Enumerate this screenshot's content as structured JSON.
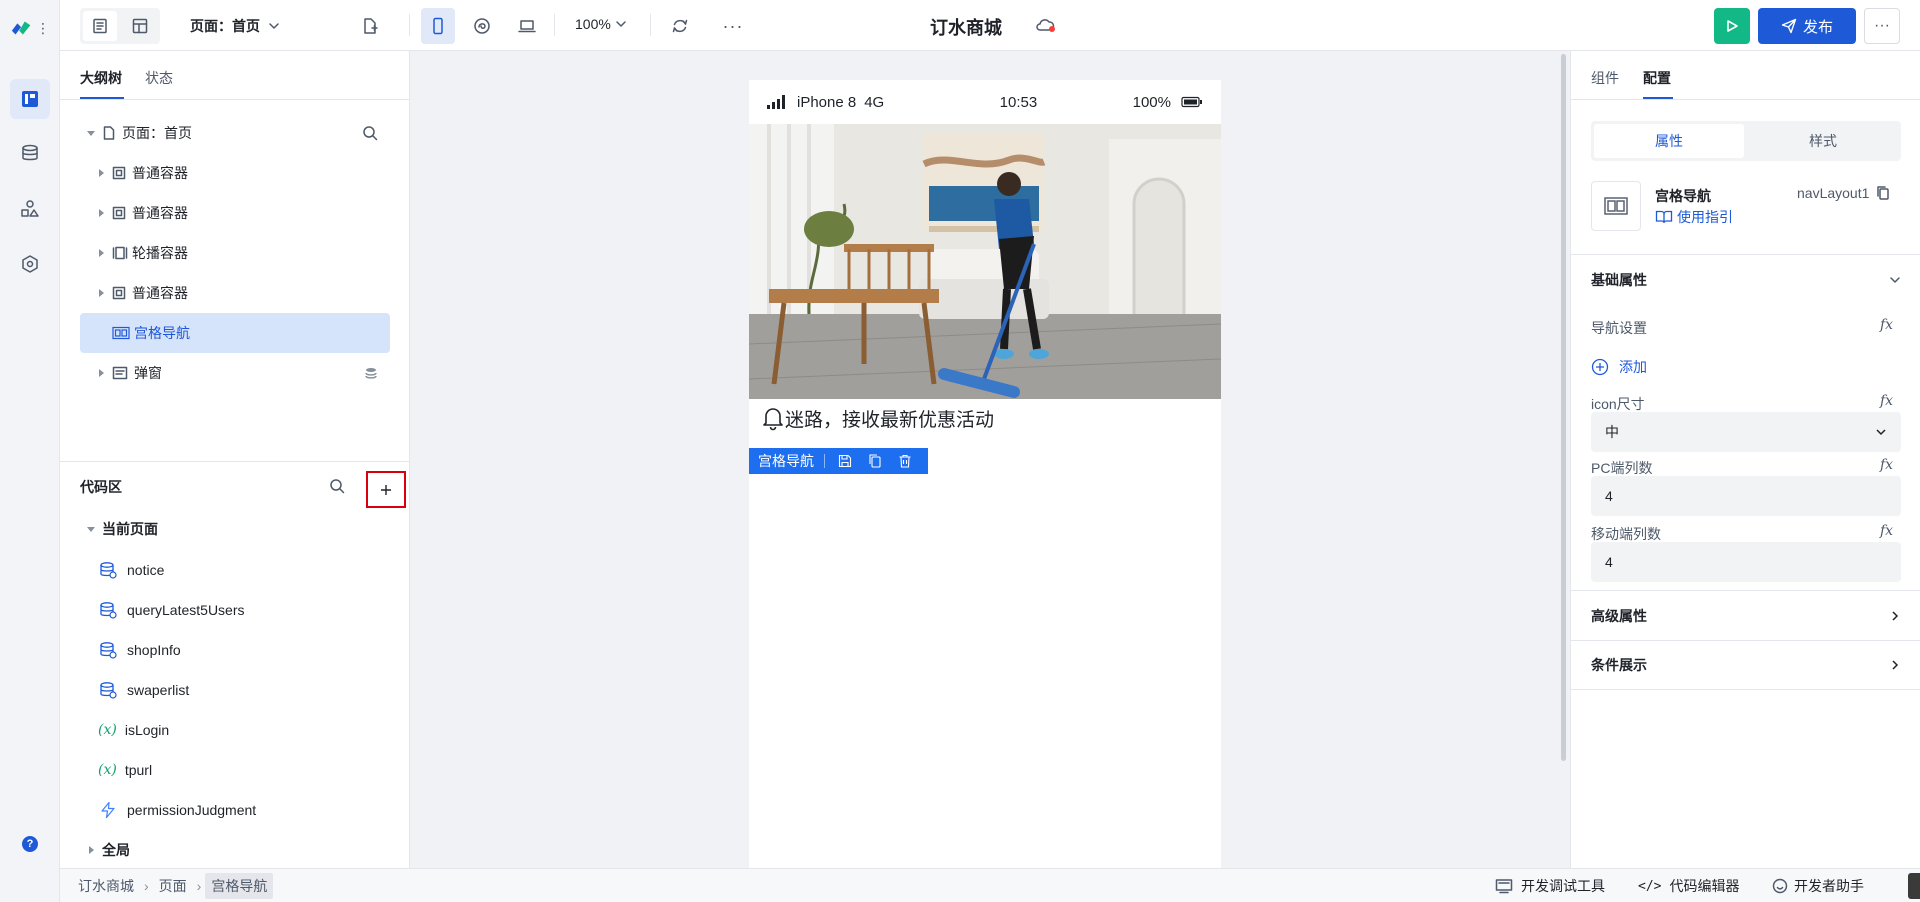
{
  "topbar": {
    "page_selector": "页面：首页",
    "zoom": "100%",
    "app_title": "订水商城",
    "publish_label": "发布"
  },
  "left_panel": {
    "tabs": [
      "大纲树",
      "状态"
    ],
    "tree": [
      {
        "label": "页面：首页",
        "icon": "page-icon"
      },
      {
        "label": "普通容器",
        "icon": "container-icon"
      },
      {
        "label": "普通容器",
        "icon": "container-icon"
      },
      {
        "label": "轮播容器",
        "icon": "carousel-icon"
      },
      {
        "label": "普通容器",
        "icon": "container-icon"
      },
      {
        "label": "宫格导航",
        "icon": "grid-nav-icon"
      },
      {
        "label": "弹窗",
        "icon": "dialog-icon"
      }
    ],
    "code_area": {
      "title": "代码区",
      "group_current": "当前页面",
      "items": [
        {
          "label": "notice",
          "icon": "database-icon"
        },
        {
          "label": "queryLatest5Users",
          "icon": "database-icon"
        },
        {
          "label": "shopInfo",
          "icon": "database-icon"
        },
        {
          "label": "swaperlist",
          "icon": "database-icon"
        },
        {
          "label": "isLogin",
          "icon": "variable-icon"
        },
        {
          "label": "tpurl",
          "icon": "variable-icon"
        },
        {
          "label": "permissionJudgment",
          "icon": "function-icon"
        }
      ],
      "group_global": "全局"
    }
  },
  "phone": {
    "status": {
      "device": "iPhone 8",
      "network": "4G",
      "time": "10:53",
      "battery": "100%"
    },
    "notice_text": "迷路，接收最新优惠活动",
    "selected_label": "宫格导航"
  },
  "right_panel": {
    "tabs": [
      "组件",
      "配置"
    ],
    "segments": [
      "属性",
      "样式"
    ],
    "component": {
      "name": "宫格导航",
      "guide": "使用指引",
      "id": "navLayout1"
    },
    "basic_title": "基础属性",
    "nav_settings": "导航设置",
    "add_label": "添加",
    "icon_size_label": "icon尺寸",
    "icon_size_value": "中",
    "pc_cols_label": "PC端列数",
    "pc_cols_value": "4",
    "mobile_cols_label": "移动端列数",
    "mobile_cols_value": "4",
    "advanced_title": "高级属性",
    "condition_title": "条件展示",
    "fx": "fx"
  },
  "statusbar": {
    "breadcrumb": [
      "订水商城",
      "页面",
      "宫格导航"
    ],
    "dev_tools": "开发调试工具",
    "code_editor": "代码编辑器",
    "dev_help": "开发者助手"
  },
  "colors": {
    "primary": "#1e5ad8",
    "run": "#12b886",
    "selected_bg": "#d6e4fb",
    "highlight_box": "#d9000d"
  }
}
